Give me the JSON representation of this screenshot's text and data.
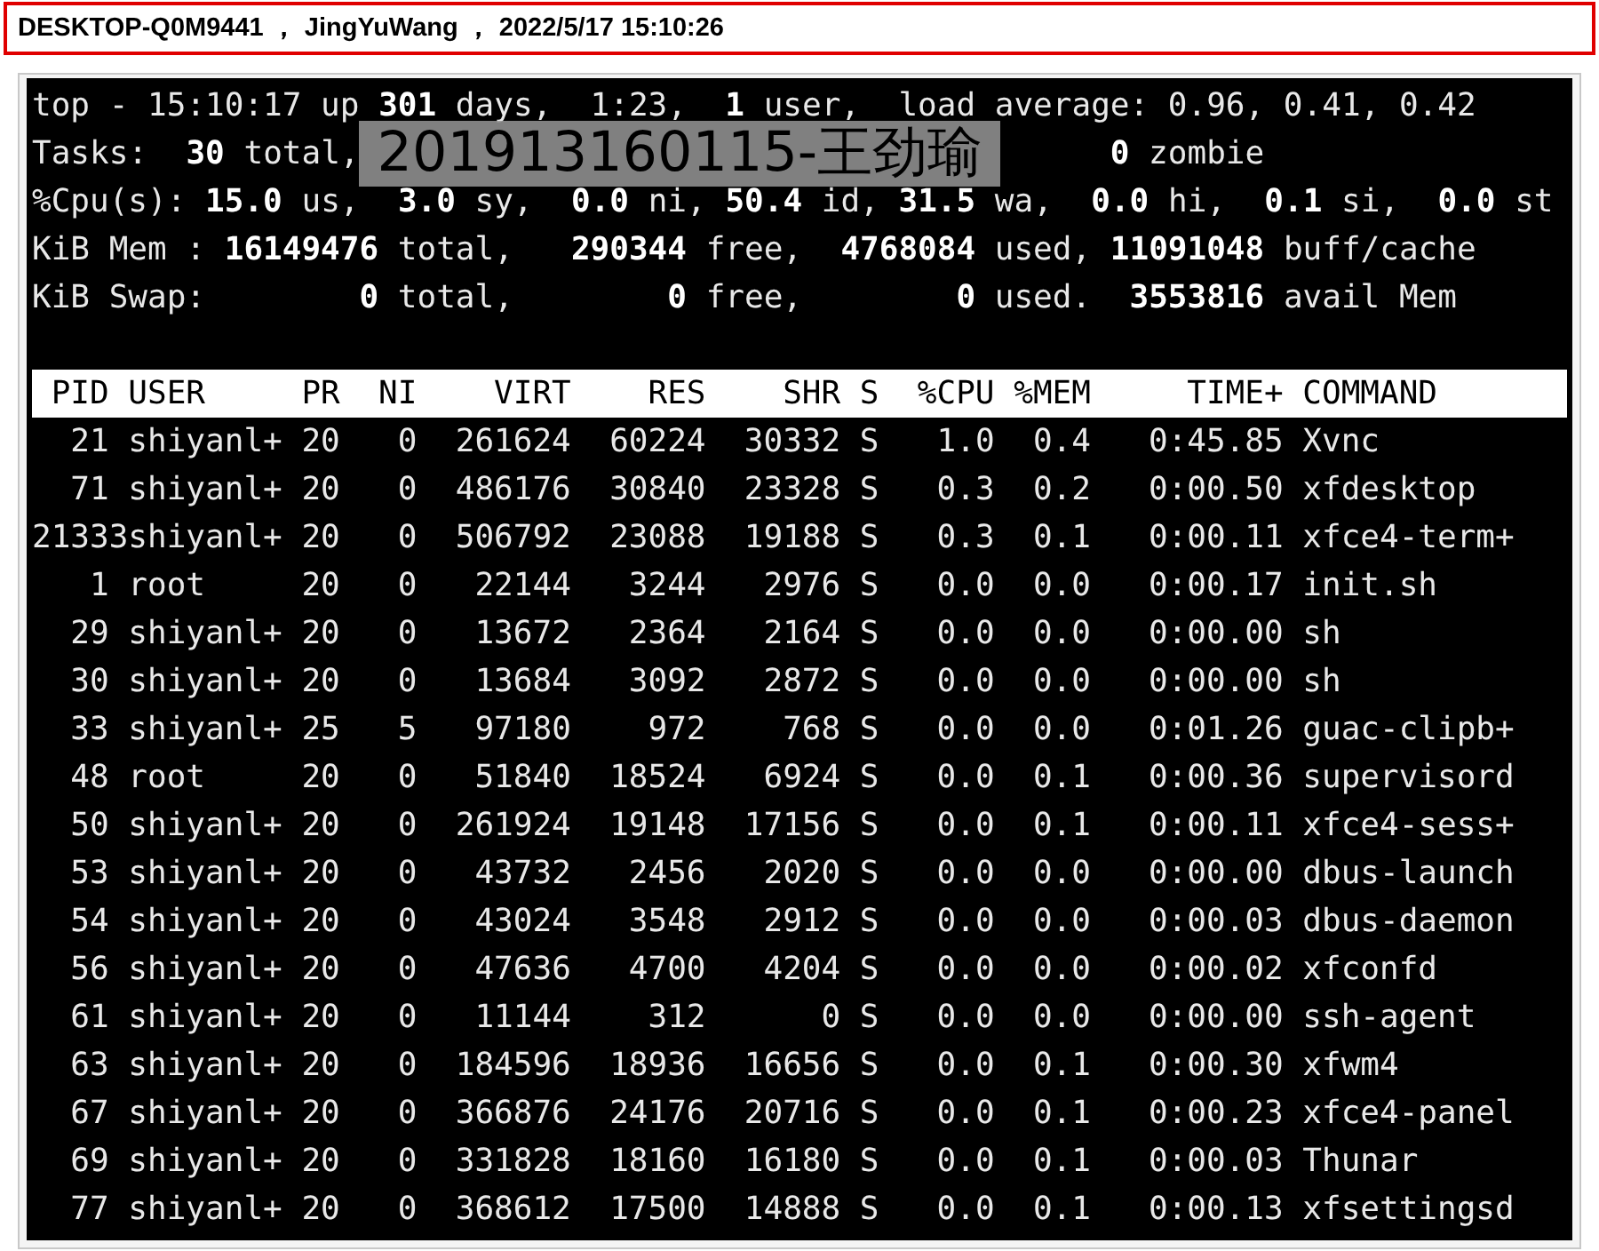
{
  "title_bar": {
    "text": "DESKTOP-Q0M9441 ， JingYuWang ， 2022/5/17 15:10:26"
  },
  "summary": {
    "uptime_line": "top - 15:10:17 up **301** days,  1:23,  **1** user,  load average: 0.96, 0.41, 0.42",
    "tasks_start": "Tasks:  **30** total,",
    "tasks_end": "**0** zombie",
    "cpu_line": "%Cpu(s): **15.0** us,  **3.0** sy,  **0.0** ni, **50.4** id, **31.5** wa,  **0.0** hi,  **0.1** si,  **0.0** st",
    "mem_line": "KiB Mem : **16149476** total,   **290344** free,  **4768084** used, **11091048** buff/cache",
    "swap_line": "KiB Swap:        **0** total,        **0** free,        **0** used.  **3553816** avail Mem"
  },
  "overlay_label": "201913160115-王劲瑜",
  "table": {
    "columns": [
      "PID",
      "USER",
      "PR",
      "NI",
      "VIRT",
      "RES",
      "SHR",
      "S",
      "%CPU",
      "%MEM",
      "TIME+",
      "COMMAND"
    ],
    "rows": [
      [
        "21",
        "shiyanl+",
        "20",
        "0",
        "261624",
        "60224",
        "30332",
        "S",
        "1.0",
        "0.4",
        "0:45.85",
        "Xvnc"
      ],
      [
        "71",
        "shiyanl+",
        "20",
        "0",
        "486176",
        "30840",
        "23328",
        "S",
        "0.3",
        "0.2",
        "0:00.50",
        "xfdesktop"
      ],
      [
        "21333",
        "shiyanl+",
        "20",
        "0",
        "506792",
        "23088",
        "19188",
        "S",
        "0.3",
        "0.1",
        "0:00.11",
        "xfce4-term+"
      ],
      [
        "1",
        "root",
        "20",
        "0",
        "22144",
        "3244",
        "2976",
        "S",
        "0.0",
        "0.0",
        "0:00.17",
        "init.sh"
      ],
      [
        "29",
        "shiyanl+",
        "20",
        "0",
        "13672",
        "2364",
        "2164",
        "S",
        "0.0",
        "0.0",
        "0:00.00",
        "sh"
      ],
      [
        "30",
        "shiyanl+",
        "20",
        "0",
        "13684",
        "3092",
        "2872",
        "S",
        "0.0",
        "0.0",
        "0:00.00",
        "sh"
      ],
      [
        "33",
        "shiyanl+",
        "25",
        "5",
        "97180",
        "972",
        "768",
        "S",
        "0.0",
        "0.0",
        "0:01.26",
        "guac-clipb+"
      ],
      [
        "48",
        "root",
        "20",
        "0",
        "51840",
        "18524",
        "6924",
        "S",
        "0.0",
        "0.1",
        "0:00.36",
        "supervisord"
      ],
      [
        "50",
        "shiyanl+",
        "20",
        "0",
        "261924",
        "19148",
        "17156",
        "S",
        "0.0",
        "0.1",
        "0:00.11",
        "xfce4-sess+"
      ],
      [
        "53",
        "shiyanl+",
        "20",
        "0",
        "43732",
        "2456",
        "2020",
        "S",
        "0.0",
        "0.0",
        "0:00.00",
        "dbus-launch"
      ],
      [
        "54",
        "shiyanl+",
        "20",
        "0",
        "43024",
        "3548",
        "2912",
        "S",
        "0.0",
        "0.0",
        "0:00.03",
        "dbus-daemon"
      ],
      [
        "56",
        "shiyanl+",
        "20",
        "0",
        "47636",
        "4700",
        "4204",
        "S",
        "0.0",
        "0.0",
        "0:00.02",
        "xfconfd"
      ],
      [
        "61",
        "shiyanl+",
        "20",
        "0",
        "11144",
        "312",
        "0",
        "S",
        "0.0",
        "0.0",
        "0:00.00",
        "ssh-agent"
      ],
      [
        "63",
        "shiyanl+",
        "20",
        "0",
        "184596",
        "18936",
        "16656",
        "S",
        "0.0",
        "0.1",
        "0:00.30",
        "xfwm4"
      ],
      [
        "67",
        "shiyanl+",
        "20",
        "0",
        "366876",
        "24176",
        "20716",
        "S",
        "0.0",
        "0.1",
        "0:00.23",
        "xfce4-panel"
      ],
      [
        "69",
        "shiyanl+",
        "20",
        "0",
        "331828",
        "18160",
        "16180",
        "S",
        "0.0",
        "0.1",
        "0:00.03",
        "Thunar"
      ],
      [
        "77",
        "shiyanl+",
        "20",
        "0",
        "368612",
        "17500",
        "14888",
        "S",
        "0.0",
        "0.1",
        "0:00.13",
        "xfsettingsd"
      ]
    ]
  }
}
